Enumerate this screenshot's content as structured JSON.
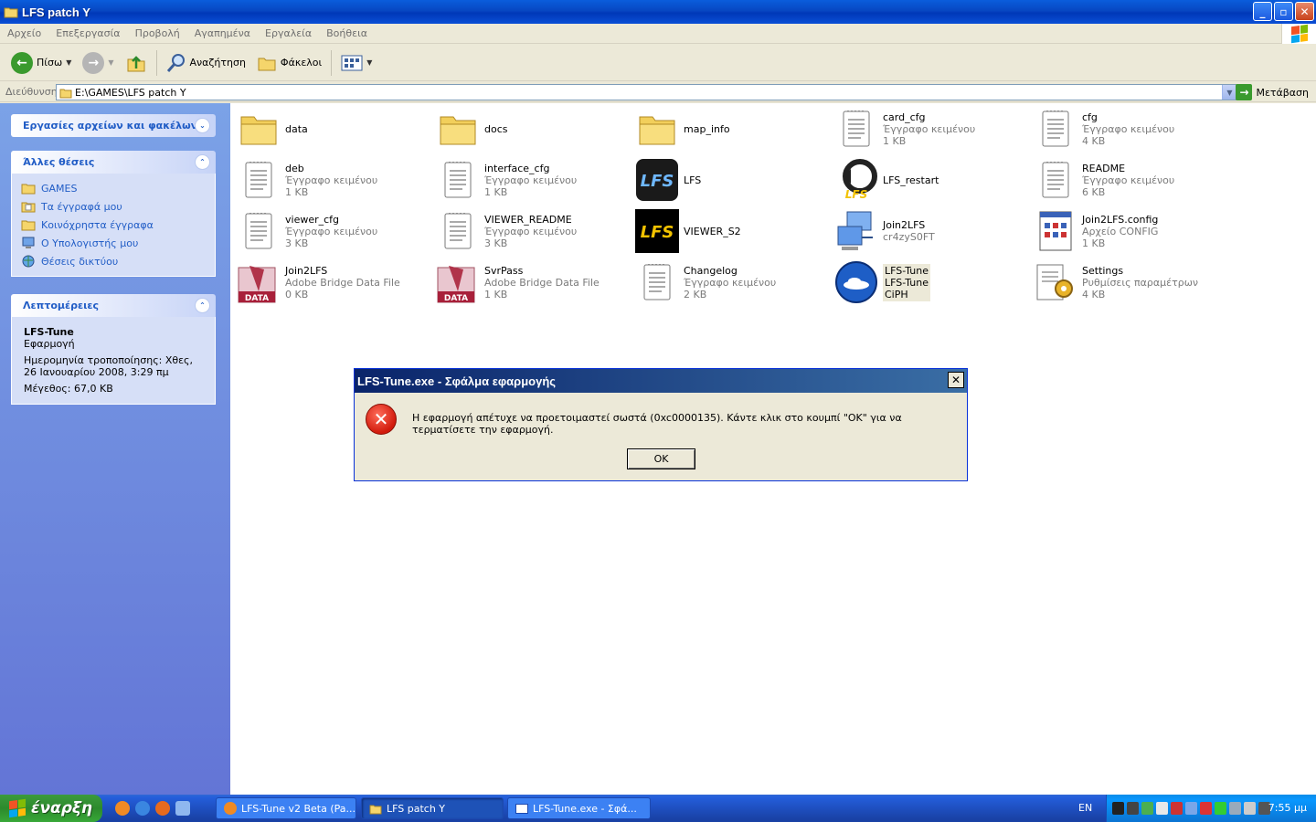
{
  "window": {
    "title": "LFS patch Y"
  },
  "menu": [
    "Αρχείο",
    "Επεξεργασία",
    "Προβολή",
    "Αγαπημένα",
    "Εργαλεία",
    "Βοήθεια"
  ],
  "toolbar": {
    "back": "Πίσω",
    "search": "Αναζήτηση",
    "folders": "Φάκελοι"
  },
  "address": {
    "label": "Διεύθυνση",
    "value": "E:\\GAMES\\LFS patch Y",
    "go": "Μετάβαση"
  },
  "left": {
    "tasks_title": "Εργασίες αρχείων και φακέλων",
    "places_title": "Άλλες θέσεις",
    "places": [
      "GAMES",
      "Τα έγγραφά μου",
      "Κοινόχρηστα έγγραφα",
      "Ο Υπολογιστής μου",
      "Θέσεις δικτύου"
    ],
    "details_title": "Λεπτομέρειες",
    "details": {
      "name": "LFS-Tune",
      "type": "Εφαρμογή",
      "modified": "Ημερομηνία τροποποίησης: Χθες, 26 Ιανουαρίου 2008, 3:29 πμ",
      "size": "Μέγεθος: 67,0 KB"
    }
  },
  "files": [
    {
      "name": "data",
      "line2": "",
      "line3": "",
      "icon": "folder-icon"
    },
    {
      "name": "docs",
      "line2": "",
      "line3": "",
      "icon": "folder-icon"
    },
    {
      "name": "map_info",
      "line2": "",
      "line3": "",
      "icon": "folder-icon"
    },
    {
      "name": "card_cfg",
      "line2": "Έγγραφο κειμένου",
      "line3": "1 KB",
      "icon": "text-document-icon"
    },
    {
      "name": "cfg",
      "line2": "Έγγραφο κειμένου",
      "line3": "4 KB",
      "icon": "text-document-icon"
    },
    {
      "name": "deb",
      "line2": "Έγγραφο κειμένου",
      "line3": "1 KB",
      "icon": "text-document-icon"
    },
    {
      "name": "interface_cfg",
      "line2": "Έγγραφο κειμένου",
      "line3": "1 KB",
      "icon": "text-document-icon"
    },
    {
      "name": "LFS",
      "line2": "",
      "line3": "",
      "icon": "lfs-app-icon"
    },
    {
      "name": "LFS_restart",
      "line2": "",
      "line3": "",
      "icon": "lfs-restart-icon"
    },
    {
      "name": "README",
      "line2": "Έγγραφο κειμένου",
      "line3": "6 KB",
      "icon": "text-document-icon"
    },
    {
      "name": "viewer_cfg",
      "line2": "Έγγραφο κειμένου",
      "line3": "3 KB",
      "icon": "text-document-icon"
    },
    {
      "name": "VIEWER_README",
      "line2": "Έγγραφο κειμένου",
      "line3": "3 KB",
      "icon": "text-document-icon"
    },
    {
      "name": "VIEWER_S2",
      "line2": "",
      "line3": "",
      "icon": "lfs-viewer-icon"
    },
    {
      "name": "Join2LFS",
      "line2": "cr4zyS0FT",
      "line3": "",
      "icon": "network-computers-icon"
    },
    {
      "name": "Join2LFS.config",
      "line2": "Αρχείο CONFIG",
      "line3": "1 KB",
      "icon": "config-file-icon"
    },
    {
      "name": "Join2LFS",
      "line2": "Adobe Bridge Data File",
      "line3": "0 KB",
      "icon": "data-file-icon"
    },
    {
      "name": "SvrPass",
      "line2": "Adobe Bridge Data File",
      "line3": "1 KB",
      "icon": "data-file-icon"
    },
    {
      "name": "Changelog",
      "line2": "Έγγραφο κειμένου",
      "line3": "2 KB",
      "icon": "text-document-icon"
    },
    {
      "name": "LFS-Tune",
      "line2": "LFS-Tune",
      "line3": "CiPH",
      "icon": "lfs-tune-icon"
    },
    {
      "name": "Settings",
      "line2": "Ρυθμίσεις παραμέτρων",
      "line3": "4 KB",
      "icon": "settings-file-icon"
    }
  ],
  "dialog": {
    "title": "LFS-Tune.exe -  Σφάλμα εφαρμογής",
    "message": "Η εφαρμογή απέτυχε να προετοιμαστεί σωστά (0xc0000135). Κάντε κλικ στο κουμπί \"OK\" για να τερματίσετε την εφαρμογή.",
    "ok": "OK"
  },
  "taskbar": {
    "start": "έναρξη",
    "tasks": [
      "LFS-Tune v2 Beta (Pa...",
      "LFS patch Y",
      "LFS-Tune.exe -  Σφά..."
    ],
    "lang": "EN",
    "clock": "7:55 μμ"
  }
}
